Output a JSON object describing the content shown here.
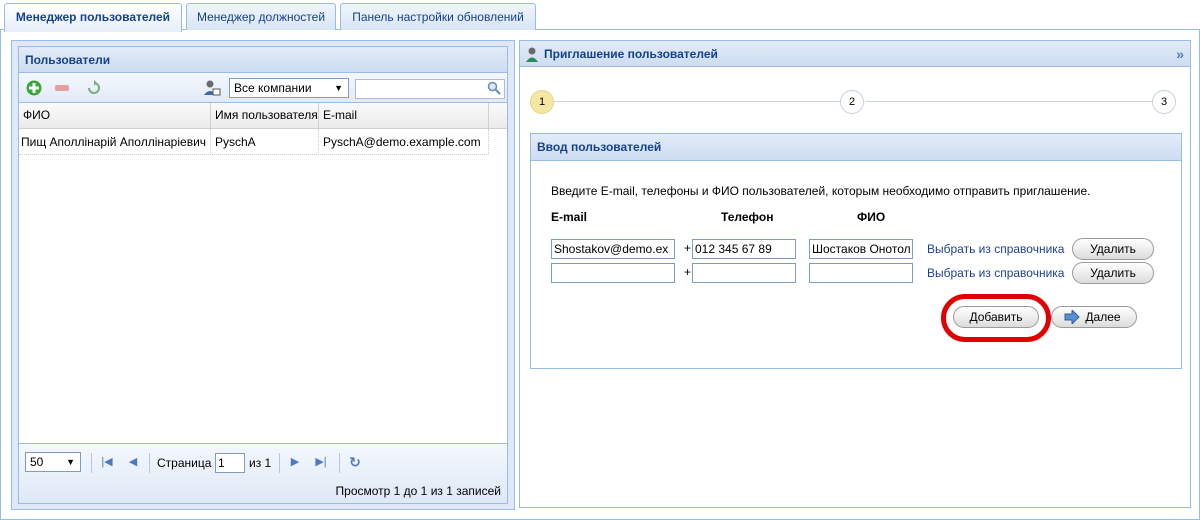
{
  "tabs": [
    {
      "label": "Менеджер пользователей",
      "active": true
    },
    {
      "label": "Менеджер должностей",
      "active": false
    },
    {
      "label": "Панель настройки обновлений",
      "active": false
    }
  ],
  "users_panel": {
    "title": "Пользователи",
    "company_select": "Все компании",
    "search_value": "",
    "columns": [
      "ФИО",
      "Имя пользователя",
      "E-mail"
    ],
    "rows": [
      {
        "fio": "Пищ Аполлінарій Аполлінаріевич",
        "username": "PyschA",
        "email": "PyschA@demo.example.com"
      }
    ],
    "pager": {
      "page_size": "50",
      "page_label": "Страница",
      "page_value": "1",
      "of_label": "из 1",
      "summary": "Просмотр 1 до 1 из 1 записей"
    }
  },
  "invite_panel": {
    "title": "Приглашение пользователей",
    "steps": [
      "1",
      "2",
      "3"
    ],
    "active_step": "1",
    "section_title": "Ввод пользователей",
    "instruction": "Введите E-mail, телефоны и ФИО пользователей, которым необходимо отправить приглашение.",
    "headers": {
      "email": "E-mail",
      "phone": "Телефон",
      "fio": "ФИО"
    },
    "rows": [
      {
        "email": "Shostakov@demo.ex",
        "plus": "+",
        "phone": "012 345 67 89",
        "fio": "Шостаков Онотол",
        "pick_label": "Выбрать из справочника",
        "delete_label": "Удалить"
      },
      {
        "email": "",
        "plus": "+",
        "phone": "",
        "fio": "",
        "pick_label": "Выбрать из справочника",
        "delete_label": "Удалить"
      }
    ],
    "add_label": "Добавить",
    "next_label": "Далее"
  },
  "colors": {
    "accent": "#15428b",
    "highlight": "#e10000",
    "border": "#99bbe8"
  }
}
